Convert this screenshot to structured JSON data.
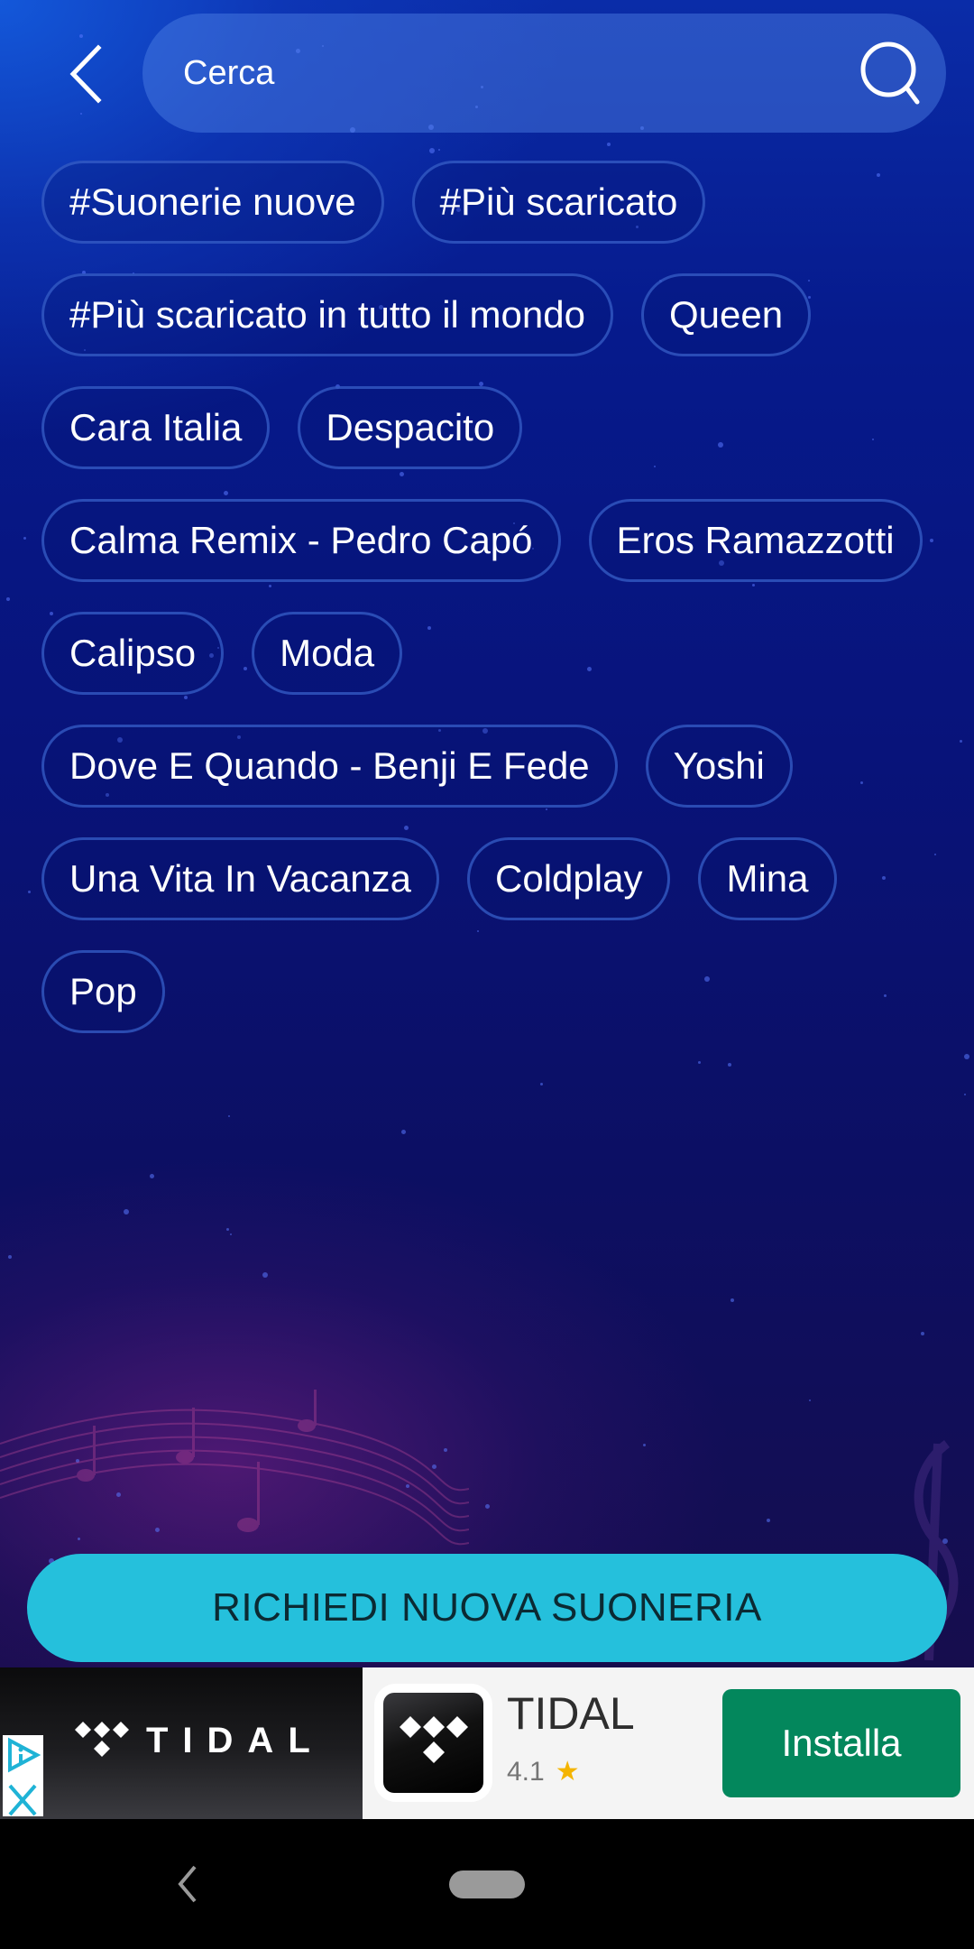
{
  "header": {
    "back_icon": "chevron-left-icon",
    "search": {
      "placeholder": "Cerca",
      "value": "",
      "icon": "search-icon"
    }
  },
  "tags": [
    "#Suonerie nuove",
    "#Più scaricato",
    "#Più scaricato in tutto il mondo",
    "Queen",
    "Cara Italia",
    "Despacito",
    "Calma Remix - Pedro Capó",
    "Eros Ramazzotti",
    "Calipso",
    "Moda",
    "Dove E Quando - Benji E Fede",
    "Yoshi",
    "Una Vita In Vacanza",
    "Coldplay",
    "Mina",
    "Pop"
  ],
  "request_button": {
    "label": "RICHIEDI NUOVA SUONERIA",
    "color": "#25c0dc"
  },
  "ad": {
    "banner_brand": "TIDAL",
    "app_name": "TIDAL",
    "rating": "4.1",
    "rating_icon": "star-icon",
    "install_label": "Installa",
    "install_color": "#03875c",
    "adchoices_icon": "adchoices-icon",
    "close_icon": "close-icon"
  },
  "navbar": {
    "back_icon": "nav-back-icon",
    "home_icon": "home-pill-icon"
  }
}
